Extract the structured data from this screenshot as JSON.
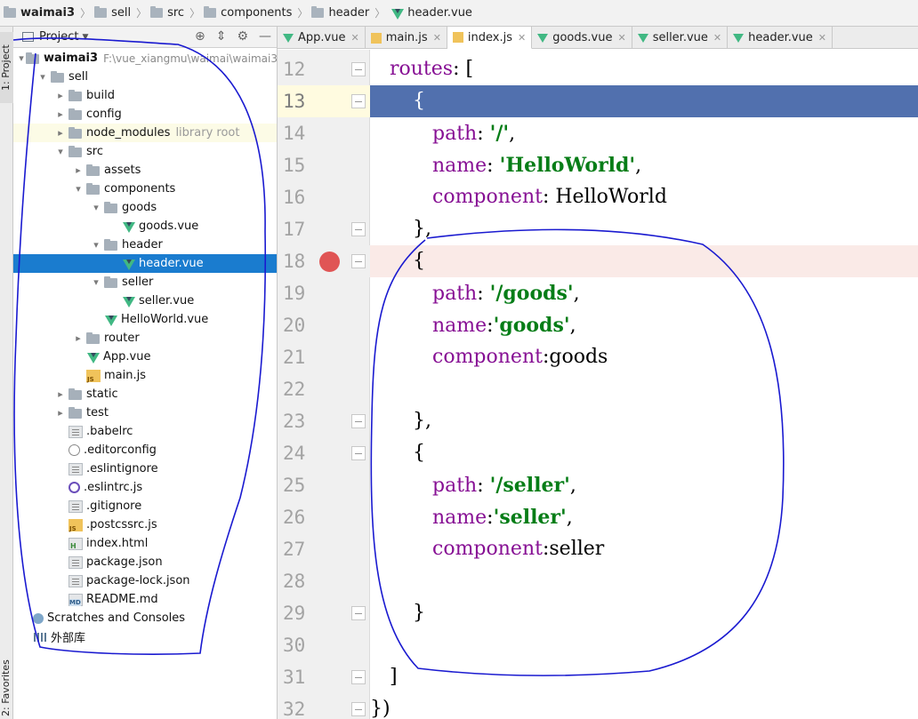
{
  "breadcrumb": [
    "waimai3",
    "sell",
    "src",
    "components",
    "header",
    "header.vue"
  ],
  "left_strip": {
    "project_tab": "1: Project",
    "favorites_tab": "2: Favorites"
  },
  "project_panel": {
    "header_title": "Project",
    "root_name": "waimai3",
    "root_path": "F:\\vue_xiangmu\\waimai\\waimai3",
    "node_modules_hint": "library root",
    "tree": [
      {
        "label": "sell",
        "icon": "folder"
      },
      {
        "label": "build",
        "icon": "folder"
      },
      {
        "label": "config",
        "icon": "folder"
      },
      {
        "label": "node_modules",
        "icon": "folder"
      },
      {
        "label": "src",
        "icon": "folder"
      },
      {
        "label": "assets",
        "icon": "folder"
      },
      {
        "label": "components",
        "icon": "folder"
      },
      {
        "label": "goods",
        "icon": "folder"
      },
      {
        "label": "goods.vue",
        "icon": "vue"
      },
      {
        "label": "header",
        "icon": "folder"
      },
      {
        "label": "header.vue",
        "icon": "vue"
      },
      {
        "label": "seller",
        "icon": "folder"
      },
      {
        "label": "seller.vue",
        "icon": "vue"
      },
      {
        "label": "HelloWorld.vue",
        "icon": "vue"
      },
      {
        "label": "router",
        "icon": "folder"
      },
      {
        "label": "App.vue",
        "icon": "vue"
      },
      {
        "label": "main.js",
        "icon": "js"
      },
      {
        "label": "static",
        "icon": "folder"
      },
      {
        "label": "test",
        "icon": "folder"
      },
      {
        "label": ".babelrc",
        "icon": "file"
      },
      {
        "label": ".editorconfig",
        "icon": "editorconfig"
      },
      {
        "label": ".eslintignore",
        "icon": "file"
      },
      {
        "label": ".eslintrc.js",
        "icon": "eslint"
      },
      {
        "label": ".gitignore",
        "icon": "file"
      },
      {
        "label": ".postcssrc.js",
        "icon": "js"
      },
      {
        "label": "index.html",
        "icon": "html"
      },
      {
        "label": "package.json",
        "icon": "file"
      },
      {
        "label": "package-lock.json",
        "icon": "file"
      },
      {
        "label": "README.md",
        "icon": "md"
      },
      {
        "label": "Scratches and Consoles",
        "icon": "scratch"
      },
      {
        "label": "外部库",
        "icon": "lib"
      }
    ],
    "selected": "header.vue"
  },
  "tabs": [
    {
      "label": "App.vue",
      "icon": "vue"
    },
    {
      "label": "main.js",
      "icon": "js"
    },
    {
      "label": "index.js",
      "icon": "js",
      "active": true
    },
    {
      "label": "goods.vue",
      "icon": "vue"
    },
    {
      "label": "seller.vue",
      "icon": "vue"
    },
    {
      "label": "header.vue",
      "icon": "vue"
    }
  ],
  "code_lines": [
    {
      "n": "12"
    },
    {
      "n": "13"
    },
    {
      "n": "14"
    },
    {
      "n": "15"
    },
    {
      "n": "16"
    },
    {
      "n": "17"
    },
    {
      "n": "18"
    },
    {
      "n": "19"
    },
    {
      "n": "20"
    },
    {
      "n": "21"
    },
    {
      "n": "22"
    },
    {
      "n": "23"
    },
    {
      "n": "24"
    },
    {
      "n": "25"
    },
    {
      "n": "26"
    },
    {
      "n": "27"
    },
    {
      "n": "28"
    },
    {
      "n": "29"
    },
    {
      "n": "30"
    },
    {
      "n": "31"
    },
    {
      "n": "32"
    }
  ],
  "code": {
    "routes_key": "routes",
    "routes_open": ": [",
    "brace_open": "{",
    "brace_close": "},",
    "brace_close_last": "}",
    "bracket_close": "]",
    "end": "})",
    "path_key": "path",
    "name_key": "name",
    "component_key": "component",
    "path_1": "'/'",
    "name_1": "'HelloWorld'",
    "component_1": "HelloWorld",
    "path_2": "'/goods'",
    "name_2": "'goods'",
    "component_2": "goods",
    "path_3": "'/seller'",
    "name_3": "'seller'",
    "component_3": "seller",
    "colon": ": ",
    "colon_nospace": ":",
    "comma": ","
  },
  "colors": {
    "accent_selection": "#1a7ccf",
    "current_line": "#5170ae",
    "breakpoint": "#e05555",
    "keyword": "#871094",
    "string": "#067d17",
    "annotation_ink": "#1a1ad0"
  }
}
